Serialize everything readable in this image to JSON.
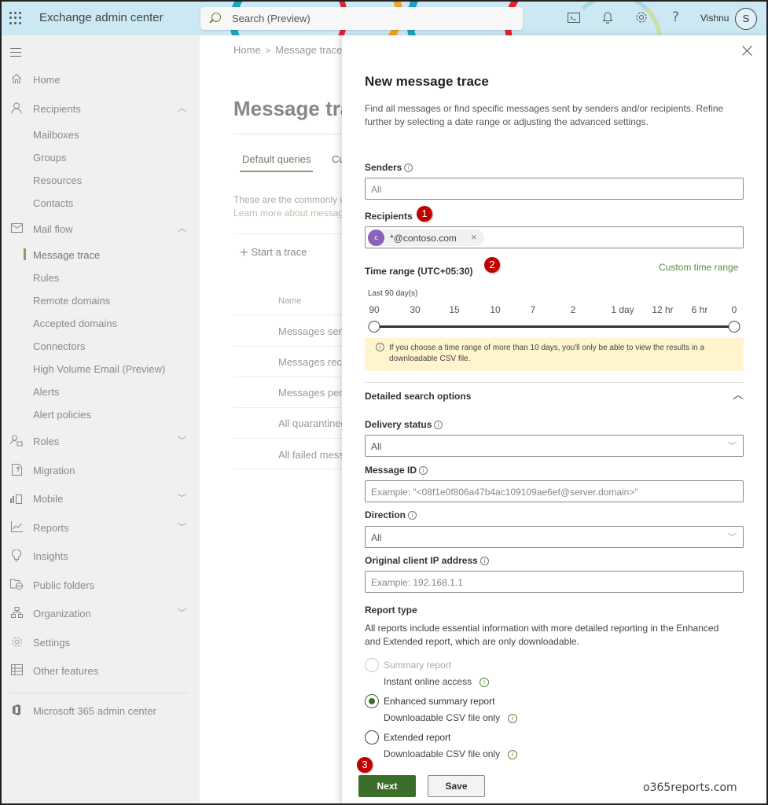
{
  "header": {
    "app_title": "Exchange admin center",
    "search_placeholder": "Search (Preview)",
    "icons": [
      "terminal-icon",
      "bell-icon",
      "gear-icon",
      "help-icon"
    ],
    "user_name": "Vishnu",
    "avatar_initial": "S"
  },
  "sidebar": {
    "items": [
      {
        "label": "Home",
        "icon": "home-icon",
        "type": "top"
      },
      {
        "label": "Recipients",
        "icon": "person-icon",
        "type": "top",
        "chevron": "up"
      },
      {
        "label": "Mailboxes",
        "type": "sub"
      },
      {
        "label": "Groups",
        "type": "sub"
      },
      {
        "label": "Resources",
        "type": "sub"
      },
      {
        "label": "Contacts",
        "type": "sub"
      },
      {
        "label": "Mail flow",
        "icon": "mail-icon",
        "type": "top",
        "chevron": "up"
      },
      {
        "label": "Message trace",
        "type": "sub",
        "active": true
      },
      {
        "label": "Rules",
        "type": "sub"
      },
      {
        "label": "Remote domains",
        "type": "sub"
      },
      {
        "label": "Accepted domains",
        "type": "sub"
      },
      {
        "label": "Connectors",
        "type": "sub"
      },
      {
        "label": "High Volume Email (Preview)",
        "type": "sub"
      },
      {
        "label": "Alerts",
        "type": "sub"
      },
      {
        "label": "Alert policies",
        "type": "sub"
      },
      {
        "label": "Roles",
        "icon": "roles-icon",
        "type": "top",
        "chevron": "down"
      },
      {
        "label": "Migration",
        "icon": "migration-icon",
        "type": "top"
      },
      {
        "label": "Mobile",
        "icon": "mobile-icon",
        "type": "top",
        "chevron": "down"
      },
      {
        "label": "Reports",
        "icon": "chart-icon",
        "type": "top",
        "chevron": "down"
      },
      {
        "label": "Insights",
        "icon": "lightbulb-icon",
        "type": "top"
      },
      {
        "label": "Public folders",
        "icon": "folder-globe-icon",
        "type": "top"
      },
      {
        "label": "Organization",
        "icon": "org-chart-icon",
        "type": "top",
        "chevron": "down"
      },
      {
        "label": "Settings",
        "icon": "gear-icon",
        "type": "top"
      },
      {
        "label": "Other features",
        "icon": "grid-icon",
        "type": "top"
      }
    ],
    "footer_link": "Microsoft 365 admin center"
  },
  "main": {
    "breadcrumb": [
      "Home",
      "Message trace"
    ],
    "page_title": "Message trace",
    "tabs": [
      "Default queries",
      "Custom queries"
    ],
    "description": "These are the commonly used message trace queries.",
    "learn_more": "Learn more about message trace",
    "start_trace_label": "Start a trace",
    "column_name": "Name",
    "queries": [
      "Messages sent from my primary domain in the last day",
      "Messages received by my primary domain in the last day",
      "Messages pending delivery",
      "All quarantined messages",
      "All failed messages"
    ]
  },
  "panel": {
    "title": "New message trace",
    "description": "Find all messages or find specific messages sent by senders and/or recipients. Refine further by selecting a date range or adjusting the advanced settings.",
    "senders": {
      "label": "Senders",
      "placeholder": "All"
    },
    "recipients": {
      "label": "Recipients",
      "chip_initial": "c",
      "chip_text": "*@contoso.com"
    },
    "time_range": {
      "label": "Time range (UTC+05:30)",
      "custom_link": "Custom time range",
      "selected_text": "Last 90 day(s)",
      "ticks": [
        "90",
        "30",
        "15",
        "10",
        "7",
        "2",
        "1 day",
        "12 hr",
        "6 hr",
        "0"
      ],
      "start_value": "90",
      "end_value": "0"
    },
    "warning": "If you choose a time range of more than 10 days, you'll only be able to view the results in a downloadable CSV file.",
    "detailed_title": "Detailed search options",
    "delivery_status": {
      "label": "Delivery status",
      "value": "All"
    },
    "message_id": {
      "label": "Message ID",
      "placeholder": "Example: \"<08f1e0f806a47b4ac109109ae6ef@server.domain>\""
    },
    "direction": {
      "label": "Direction",
      "value": "All"
    },
    "client_ip": {
      "label": "Original client IP address",
      "placeholder": "Example: 192.168.1.1"
    },
    "report_type": {
      "label": "Report type",
      "description": "All reports include essential information with more detailed reporting in the Enhanced and Extended report, which are only downloadable.",
      "options": [
        {
          "label": "Summary report",
          "sub": "Instant online access",
          "state": "disabled"
        },
        {
          "label": "Enhanced summary report",
          "sub": "Downloadable CSV file only",
          "state": "checked"
        },
        {
          "label": "Extended report",
          "sub": "Downloadable CSV file only",
          "state": "unchecked"
        }
      ]
    },
    "next_label": "Next",
    "save_label": "Save",
    "annotations": [
      "1",
      "2",
      "3"
    ],
    "annotation_color": "#c00000",
    "accent_color": "#3b6e2a"
  },
  "watermark": "o365reports.com"
}
